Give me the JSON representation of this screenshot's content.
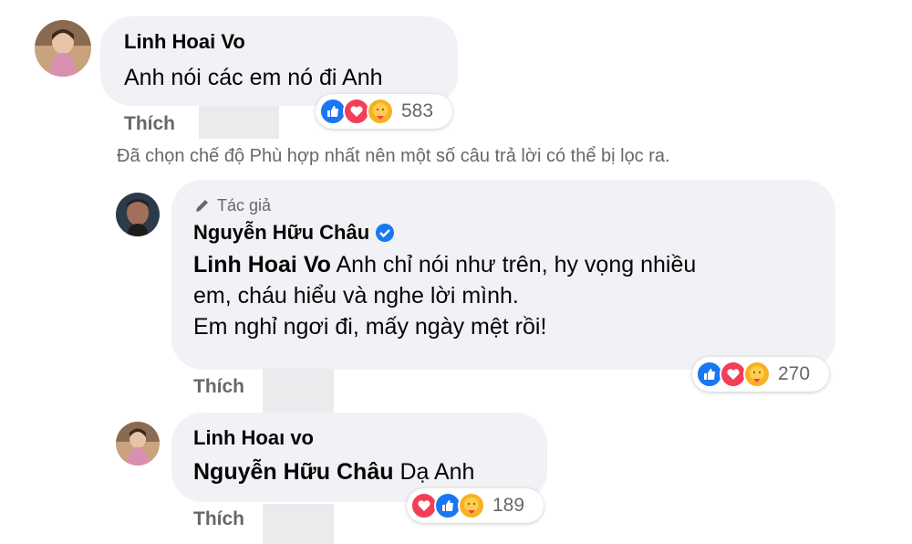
{
  "comments": [
    {
      "author": "Linh Hoai Vo",
      "text": "Anh nói các em nó đi Anh",
      "like_label": "Thích",
      "reaction_count": "583",
      "reactions": [
        "like-icon",
        "love-icon",
        "care-icon"
      ]
    }
  ],
  "filter_notice": "Đã chọn chế độ Phù hợp nhất nên một số câu trả lời có thể bị lọc ra.",
  "replies": [
    {
      "badge": "Tác giả",
      "author": "Nguyễn Hữu Châu",
      "mention": "Linh Hoai Vo",
      "line1": " Anh chỉ nói như trên, hy vọng nhiều",
      "line2": "em, cháu hiểu và nghe lời mình.",
      "line3": "Em nghỉ ngơi đi, mấy ngày mệt rồi!",
      "like_label": "Thích",
      "reaction_count": "270",
      "reactions": [
        "like-icon",
        "love-icon",
        "care-icon"
      ]
    },
    {
      "author": "Linh Hoaı vo",
      "mention": "Nguyễn Hữu Châu",
      "text": " Dạ Anh",
      "like_label": "Thích",
      "reaction_count": "189",
      "reactions": [
        "love-icon",
        "like-icon",
        "care-icon"
      ]
    }
  ],
  "colors": {
    "like": "#1877f2",
    "love": "#f33e58",
    "care": "#f7b125",
    "verified": "#1877f2"
  }
}
